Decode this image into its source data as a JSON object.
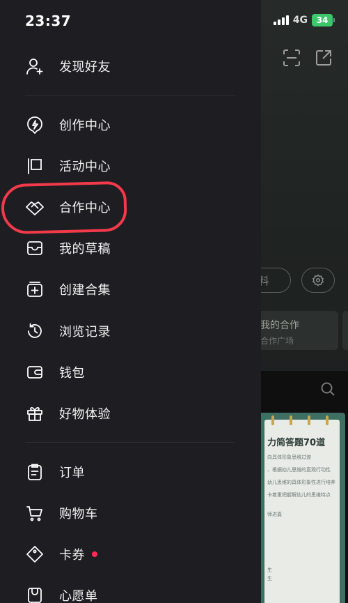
{
  "status_bar": {
    "time": "23:37",
    "network": "4G",
    "battery": "34"
  },
  "drawer": {
    "group1": [
      {
        "label": "发现好友",
        "icon": "add-user-icon"
      }
    ],
    "group2": [
      {
        "label": "创作中心",
        "icon": "lightning-icon"
      },
      {
        "label": "活动中心",
        "icon": "flag-icon"
      },
      {
        "label": "合作中心",
        "icon": "handshake-icon"
      },
      {
        "label": "我的草稿",
        "icon": "inbox-icon"
      },
      {
        "label": "创建合集",
        "icon": "add-collection-icon"
      },
      {
        "label": "浏览记录",
        "icon": "history-clock-icon"
      },
      {
        "label": "钱包",
        "icon": "wallet-icon"
      },
      {
        "label": "好物体验",
        "icon": "gift-icon"
      }
    ],
    "group3": [
      {
        "label": "订单",
        "icon": "clipboard-icon"
      },
      {
        "label": "购物车",
        "icon": "cart-icon"
      },
      {
        "label": "卡券",
        "icon": "coupon-icon",
        "has_dot": true
      },
      {
        "label": "心愿单",
        "icon": "wishlist-icon"
      }
    ]
  },
  "background": {
    "edit_profile_partial": "料",
    "collab_card_title": "我的合作",
    "collab_card_subtitle": "合作广场",
    "thumb_title": "力简答题70道",
    "thumb_lines": [
      "向具体形象思维过渡",
      "、根据幼儿思维的直观行动性",
      "幼儿思维的具体形象性进行培养",
      "卡着重把握解幼儿的思维特点",
      "师进嘉",
      "生",
      "生"
    ]
  },
  "colors": {
    "drawer_bg": "#1e1e22",
    "highlight": "#f23a4b",
    "badge_dot": "#ff2d55",
    "battery": "#3ec76a"
  }
}
